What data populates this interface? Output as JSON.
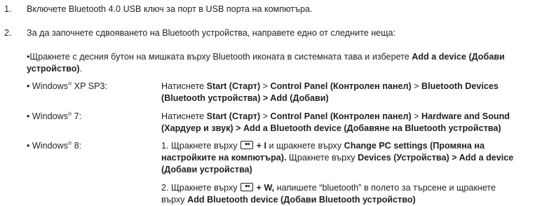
{
  "steps": [
    {
      "num": "1.",
      "text": "Включете Bluetooth 4.0 USB ключ за порт в USB порта на компютъра."
    },
    {
      "num": "2.",
      "text": "За да започнете сдвояването на Bluetooth устройства, направете едно от следните неща:"
    }
  ],
  "intro": {
    "prefix": "•Щракнете с десния бутон на мишката върху Bluetooth иконата в системната тава и изберете ",
    "bold1": "Add a device (Добави",
    "bold2": "устройство)",
    "suffix": "."
  },
  "os_rows": [
    {
      "label": "• Windows",
      "sup": "®",
      "label_rest": " XP SP3:",
      "line1_parts": [
        {
          "t": "Натиснете ",
          "b": false
        },
        {
          "t": "Start (Старт)",
          "b": true
        },
        {
          "t": " > ",
          "b": false
        },
        {
          "t": "Control Panel (Контролен панел)",
          "b": true
        },
        {
          "t": " > ",
          "b": false
        },
        {
          "t": "Bluetooth Devices",
          "b": true
        }
      ],
      "line2_parts": [
        {
          "t": "(Bluetooth устройства) > Add (Добави)",
          "b": true
        }
      ]
    },
    {
      "label": "• Windows",
      "sup": "®",
      "label_rest": " 7:",
      "line1_parts": [
        {
          "t": "Натиснете ",
          "b": false
        },
        {
          "t": "Start (Старт)",
          "b": true
        },
        {
          "t": " > ",
          "b": false
        },
        {
          "t": "Control Panel (Контролен панел)",
          "b": true
        },
        {
          "t": " > ",
          "b": false
        },
        {
          "t": "Hardware and Sound",
          "b": true
        }
      ],
      "line2_parts": [
        {
          "t": "(Хардуер и звук) > Add a Bluetooth device (Добавяне на Bluetooth устройства)",
          "b": true
        }
      ]
    }
  ],
  "win8": {
    "label": "• Windows",
    "sup": "®",
    "label_rest": " 8:",
    "item1": {
      "pre": "1. Щракнете върху ",
      "key_suffix": " + I",
      "mid": " и щракнете върху ",
      "bold_a": "Change PC settings (Промяна на",
      "bold_b": "настройките на компютъра).",
      "mid2": " Щракнете върху ",
      "bold_c": "Devices (Устройства) > Add a device",
      "bold_d": "(Добави устройства)"
    },
    "item2": {
      "pre": "2. Щракнете върху ",
      "key_suffix": " + W,",
      "mid": " напишете “bluetooth” в полето за търсене и щракнете",
      "line2_pre": "върху ",
      "line2_bold": "Add Bluetooth device (Добави Bluetooth устройство)"
    },
    "key_icon": "windows-key-icon"
  }
}
